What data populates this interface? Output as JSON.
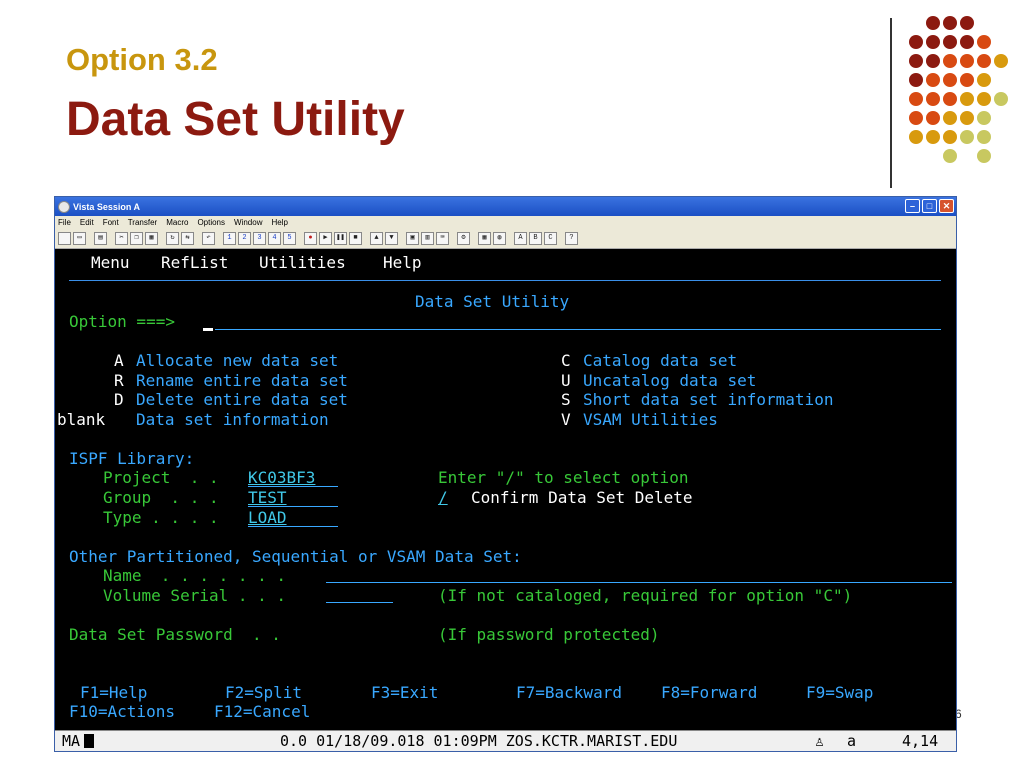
{
  "slide": {
    "subtitle": "Option 3.2",
    "title": "Data Set Utility",
    "page_number": "6",
    "dot_colors": {
      "dark": "#8c1a10",
      "orange": "#d84a12",
      "gold": "#d89a0e",
      "olive": "#c8c860"
    }
  },
  "window": {
    "title": "Vista Session A",
    "menu": [
      "File",
      "Edit",
      "Font",
      "Transfer",
      "Macro",
      "Options",
      "Window",
      "Help"
    ],
    "toolbar_letters": [
      "A",
      "B",
      "C",
      "?"
    ]
  },
  "ispf": {
    "menu": {
      "menu": "Menu",
      "reflist": "RefList",
      "utilities": "Utilities",
      "help": "Help"
    },
    "panel_title": "Data Set Utility",
    "option_prompt": "Option ===>",
    "options": {
      "a_key": "A",
      "a_text": "Allocate new data set",
      "r_key": "R",
      "r_text": "Rename entire data set",
      "d_key": "D",
      "d_text": "Delete entire data set",
      "blank_key": "blank",
      "blank_text": "Data set information",
      "c_key": "C",
      "c_text": "Catalog data set",
      "u_key": "U",
      "u_text": "Uncatalog data set",
      "s_key": "S",
      "s_text": "Short data set information",
      "v_key": "V",
      "v_text": "VSAM Utilities"
    },
    "library": {
      "heading": "ISPF Library:",
      "project_label": "Project  . .",
      "project_value": "KC03BF3",
      "group_label": "Group  . . .",
      "group_value": "TEST",
      "type_label": "Type . . . .",
      "type_value": "LOAD",
      "select_hint": "Enter \"/\" to select option",
      "confirm_value": "/",
      "confirm_label": "Confirm Data Set Delete"
    },
    "other": {
      "heading": "Other Partitioned, Sequential or VSAM Data Set:",
      "name_label": "Name  . . . . . . .",
      "volume_label": "Volume Serial . . .",
      "volume_hint": "(If not cataloged, required for option \"C\")"
    },
    "password": {
      "label": "Data Set Password  . .",
      "hint": "(If password protected)"
    },
    "fkeys": {
      "f1": "F1=Help",
      "f2": "F2=Split",
      "f3": "F3=Exit",
      "f7": "F7=Backward",
      "f8": "F8=Forward",
      "f9": "F9=Swap",
      "f10": "F10=Actions",
      "f12": "F12=Cancel"
    }
  },
  "statusbar": {
    "mode": "MA",
    "info": "0.0 01/18/09.018 01:09PM ZOS.KCTR.MARIST.EDU",
    "session": "a",
    "cursor_pos": "4,14"
  }
}
